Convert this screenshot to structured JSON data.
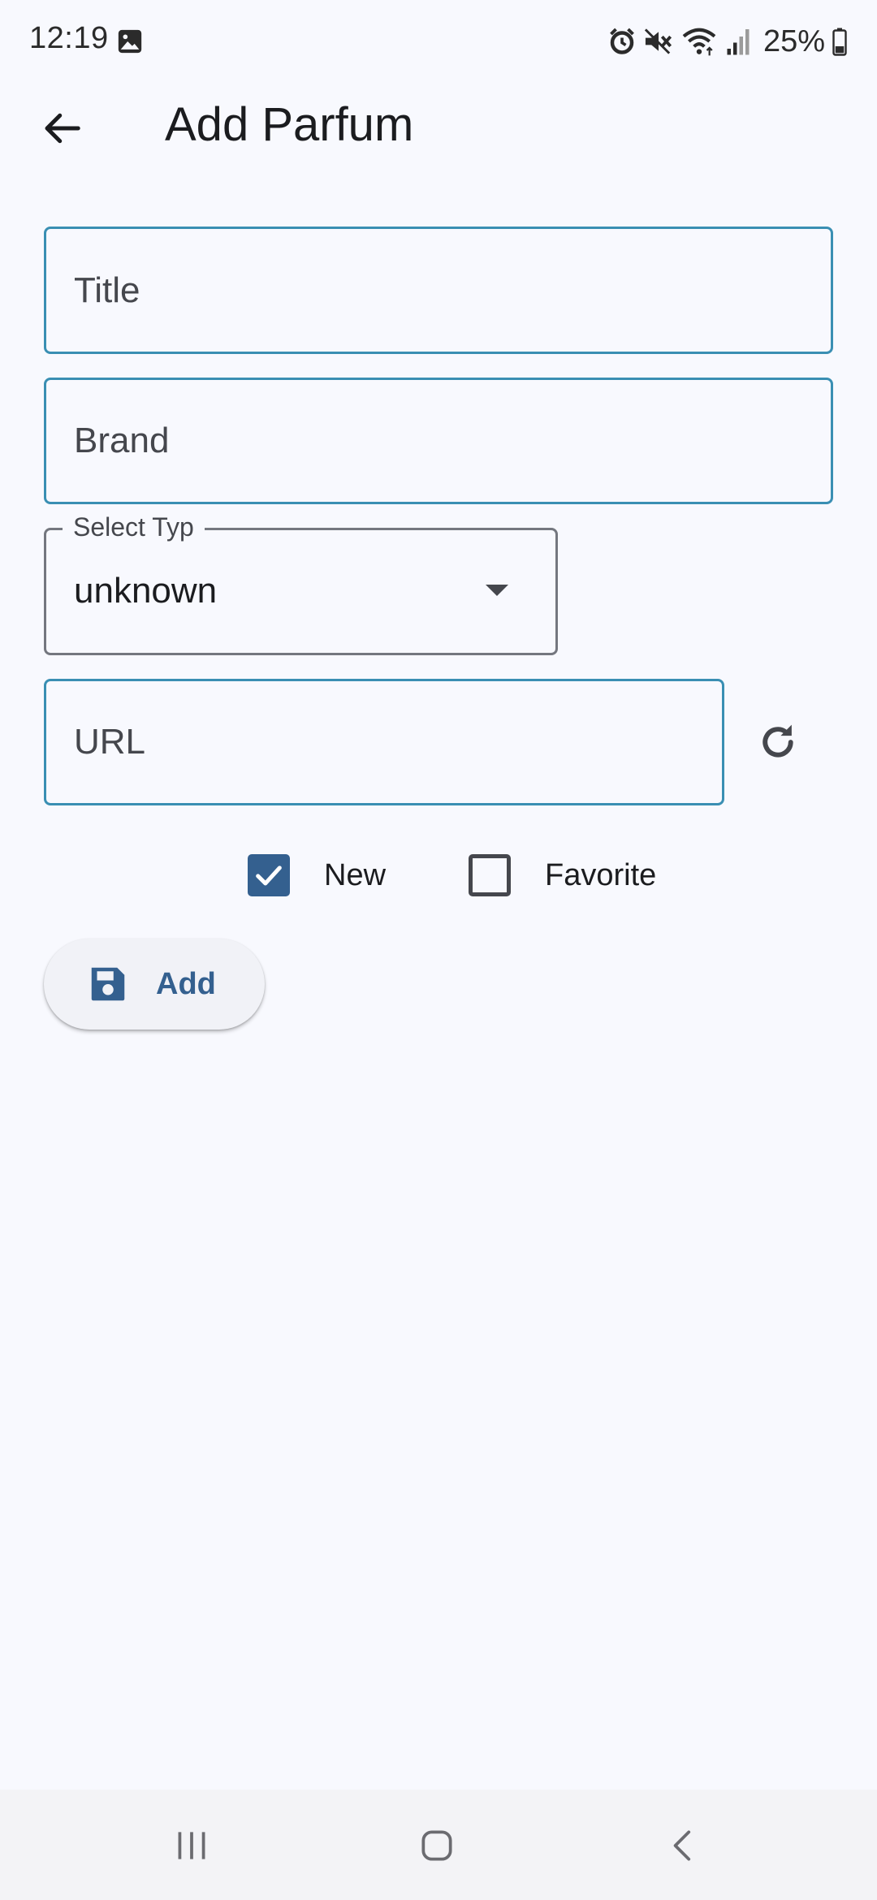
{
  "status_bar": {
    "time": "12:19",
    "battery": "25%",
    "icons": [
      "gallery-icon",
      "alarm-icon",
      "mute-icon",
      "wifi-icon",
      "signal-icon",
      "battery-icon"
    ]
  },
  "app_bar": {
    "title": "Add Parfum",
    "back_icon": "arrow-left-icon"
  },
  "form": {
    "title_field": {
      "placeholder": "Title",
      "value": ""
    },
    "brand_field": {
      "placeholder": "Brand",
      "value": ""
    },
    "type_select": {
      "label": "Select Typ",
      "value": "unknown"
    },
    "url_field": {
      "placeholder": "URL",
      "value": ""
    },
    "refresh_icon": "refresh-icon",
    "checkboxes": [
      {
        "label": "New",
        "checked": true
      },
      {
        "label": "Favorite",
        "checked": false
      }
    ],
    "add_button": {
      "label": "Add",
      "icon": "save-icon"
    }
  },
  "colors": {
    "background": "#f8f9fe",
    "field_border": "#3a8fb3",
    "primary": "#34608f",
    "text": "#1b1c1f"
  },
  "nav_bar": {
    "icons": [
      "recents-icon",
      "home-icon",
      "back-icon"
    ]
  }
}
